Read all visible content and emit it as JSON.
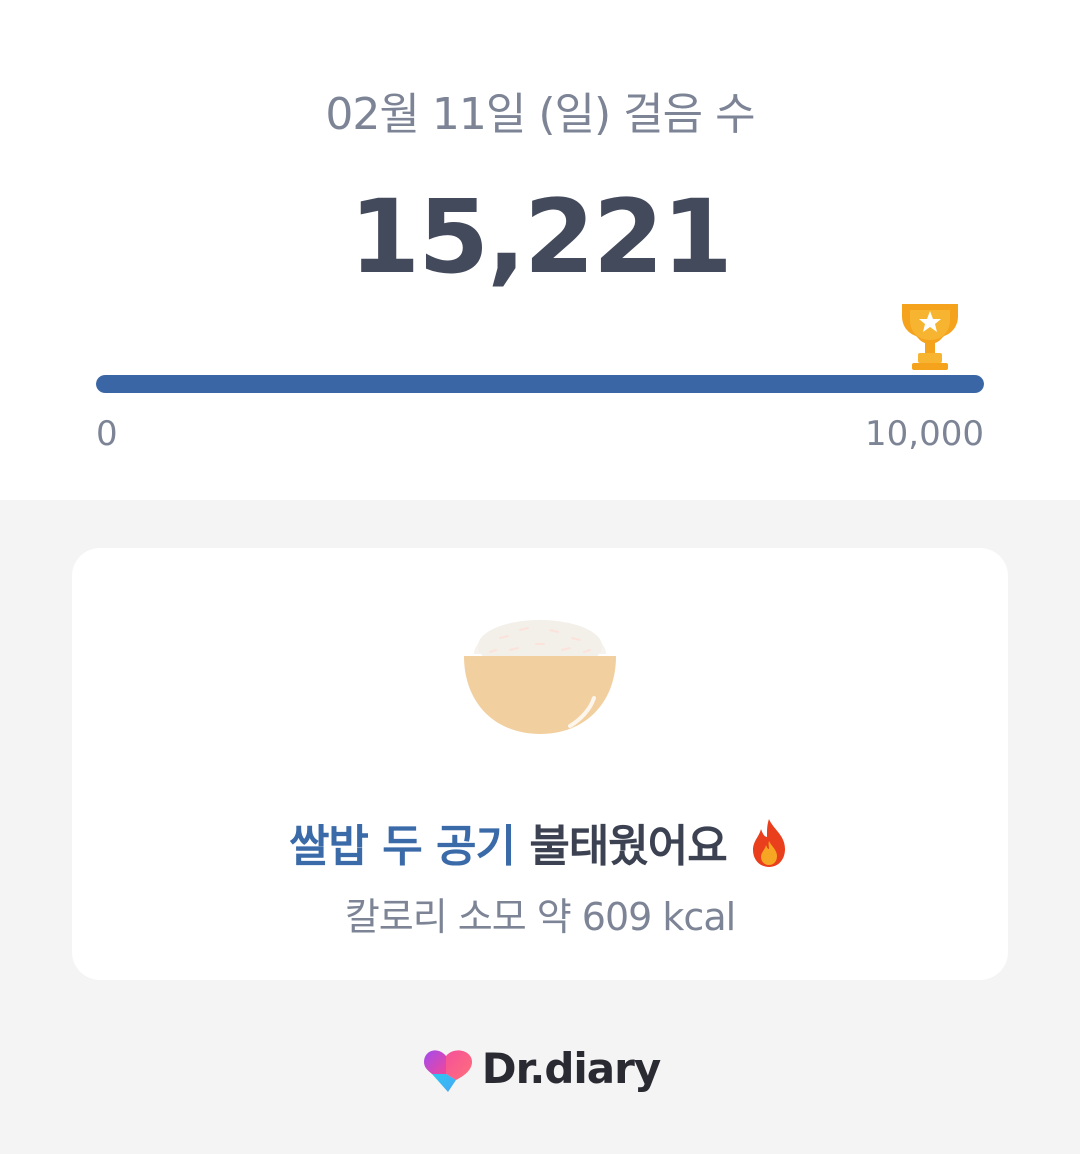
{
  "header": {
    "date_title": "02월 11일 (일) 걸음 수",
    "steps": "15,221"
  },
  "progress": {
    "min_label": "0",
    "max_label": "10,000",
    "fraction": 1.0,
    "bar_color": "#3a66a6",
    "goal_icon": "trophy-icon"
  },
  "summary_card": {
    "food_icon": "rice-bowl-icon",
    "burn_highlight": "쌀밥 두 공기",
    "burn_rest": " 불태웠어요",
    "burn_icon": "fire-icon",
    "calorie_text": "칼로리 소모 약 609 kcal",
    "highlight_color": "#3a6aa8"
  },
  "brand": {
    "logo_icon": "dr-diary-logo-icon",
    "name": "Dr.diary"
  }
}
